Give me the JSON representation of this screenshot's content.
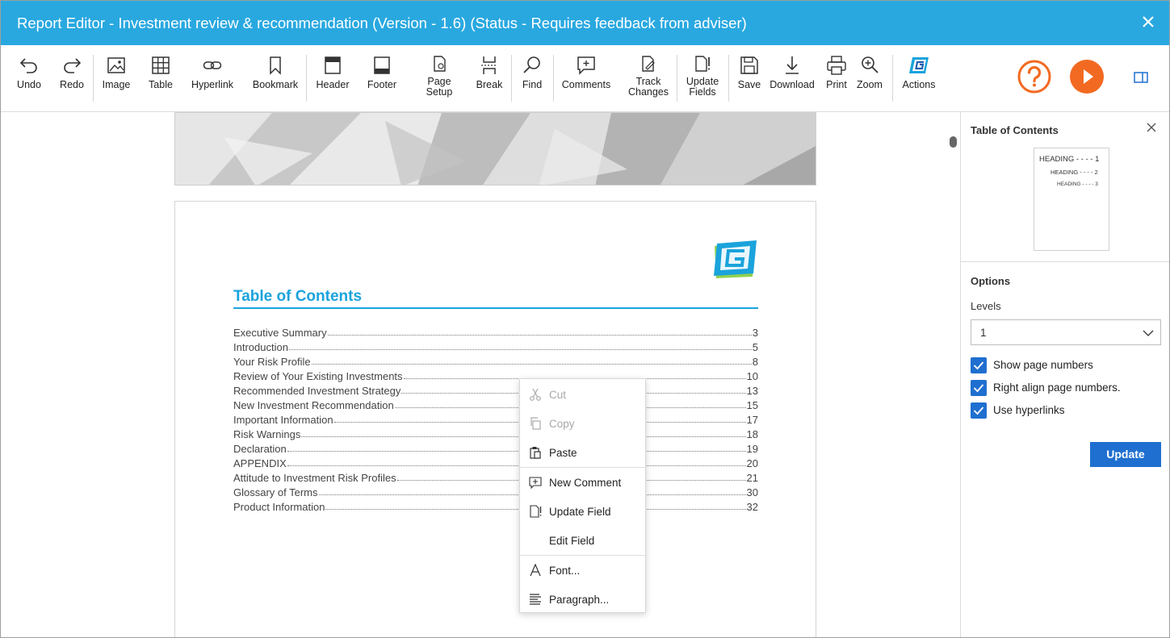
{
  "window": {
    "title": "Report Editor - Investment review & recommendation (Version - 1.6) (Status - Requires feedback from adviser)"
  },
  "toolbar": {
    "undo": "Undo",
    "redo": "Redo",
    "image": "Image",
    "table": "Table",
    "hyperlink": "Hyperlink",
    "bookmark": "Bookmark",
    "header": "Header",
    "footer": "Footer",
    "page_setup_1": "Page",
    "page_setup_2": "Setup",
    "break": "Break",
    "find": "Find",
    "comments": "Comments",
    "track_changes_1": "Track",
    "track_changes_2": "Changes",
    "update_fields_1": "Update",
    "update_fields_2": "Fields",
    "save": "Save",
    "download": "Download",
    "print": "Print",
    "zoom": "Zoom",
    "actions": "Actions"
  },
  "document": {
    "toc_heading": "Table of Contents",
    "entries": [
      {
        "title": "Executive Summary",
        "page": "3"
      },
      {
        "title": "Introduction",
        "page": "5"
      },
      {
        "title": "Your Risk Profile",
        "page": "8"
      },
      {
        "title": "Review of Your Existing Investments",
        "page": "10"
      },
      {
        "title": "Recommended Investment Strategy",
        "page": "13"
      },
      {
        "title": "New Investment Recommendation",
        "page": "15"
      },
      {
        "title": "Important Information",
        "page": "17"
      },
      {
        "title": "Risk Warnings",
        "page": "18"
      },
      {
        "title": "Declaration",
        "page": "19"
      },
      {
        "title": "APPENDIX",
        "page": "20"
      },
      {
        "title": "Attitude to Investment Risk Profiles",
        "page": "21"
      },
      {
        "title": "Glossary of Terms",
        "page": "30"
      },
      {
        "title": "Product Information",
        "page": "32"
      }
    ]
  },
  "context_menu": {
    "cut": "Cut",
    "copy": "Copy",
    "paste": "Paste",
    "new_comment": "New Comment",
    "update_field": "Update Field",
    "edit_field": "Edit Field",
    "font": "Font...",
    "paragraph": "Paragraph..."
  },
  "side_panel": {
    "title": "Table of Contents",
    "preview": {
      "h1": "HEADING - - - - 1",
      "h2": "HEADING - - - - 2",
      "h3": "HEADING - - - - 3"
    },
    "options_title": "Options",
    "levels_label": "Levels",
    "levels_value": "1",
    "show_page_numbers": "Show page numbers",
    "right_align": "Right align page numbers.",
    "use_hyperlinks": "Use hyperlinks",
    "update_button": "Update"
  },
  "colors": {
    "titlebar": "#29a8e0",
    "accent_orange": "#f26a21",
    "primary_blue": "#1f6fd0",
    "toc_blue": "#1aa3dc"
  }
}
